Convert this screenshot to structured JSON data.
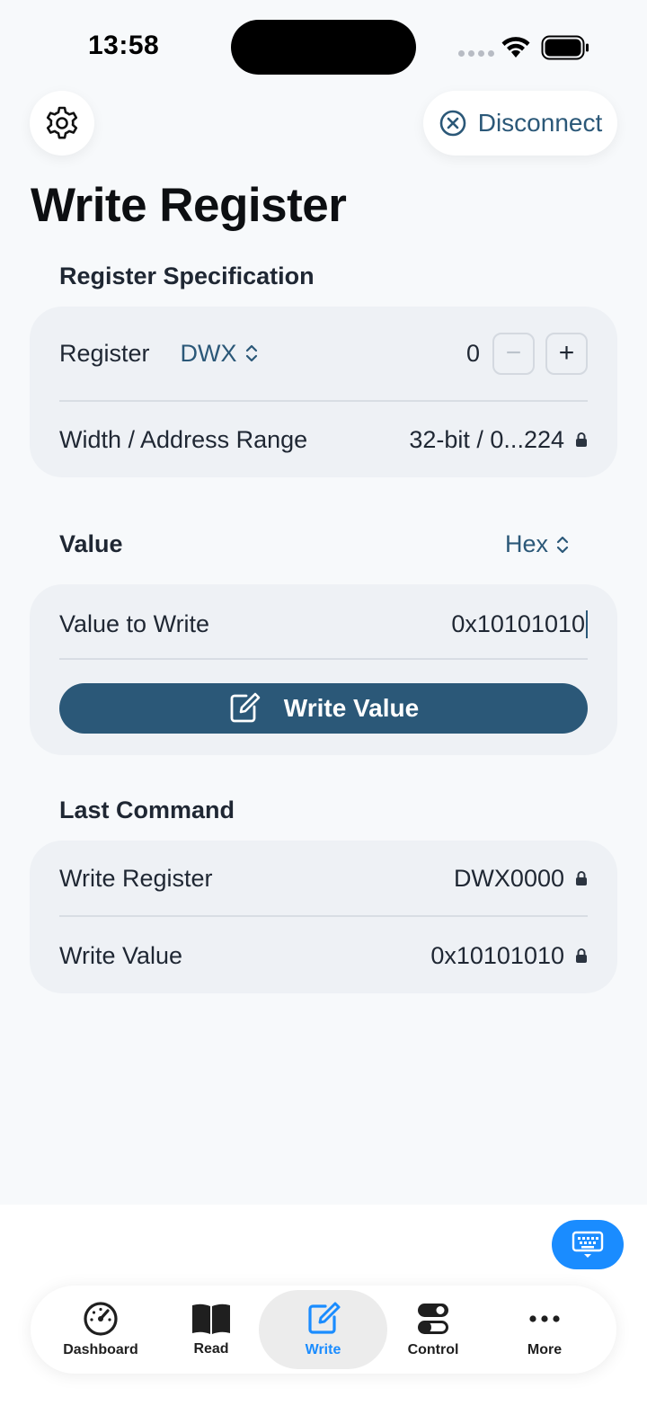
{
  "status_bar": {
    "time": "13:58"
  },
  "header": {
    "settings_icon": "gear-icon",
    "disconnect_label": "Disconnect",
    "title": "Write Register"
  },
  "register_spec": {
    "header": "Register Specification",
    "register_label": "Register",
    "register_type": "DWX",
    "address_value": "0",
    "decrement_label": "−",
    "increment_label": "+",
    "width_label": "Width / Address Range",
    "width_value": "32-bit / 0...224"
  },
  "value_section": {
    "header": "Value",
    "format": "Hex",
    "value_label": "Value to Write",
    "value": "0x10101010",
    "write_button_label": "Write Value"
  },
  "last_command": {
    "header": "Last Command",
    "register_label": "Write Register",
    "register_value": "DWX0000",
    "value_label": "Write Value",
    "value_value": "0x10101010"
  },
  "tab_bar": {
    "tabs": [
      {
        "label": "Dashboard",
        "icon": "gauge-icon"
      },
      {
        "label": "Read",
        "icon": "book-icon"
      },
      {
        "label": "Write",
        "icon": "edit-icon",
        "active": true
      },
      {
        "label": "Control",
        "icon": "toggles-icon"
      },
      {
        "label": "More",
        "icon": "ellipsis-icon"
      }
    ]
  },
  "colors": {
    "accent": "#2b5878",
    "tab_active": "#1a8cff",
    "card_bg": "#eef1f5",
    "page_bg": "#f7f9fb"
  }
}
